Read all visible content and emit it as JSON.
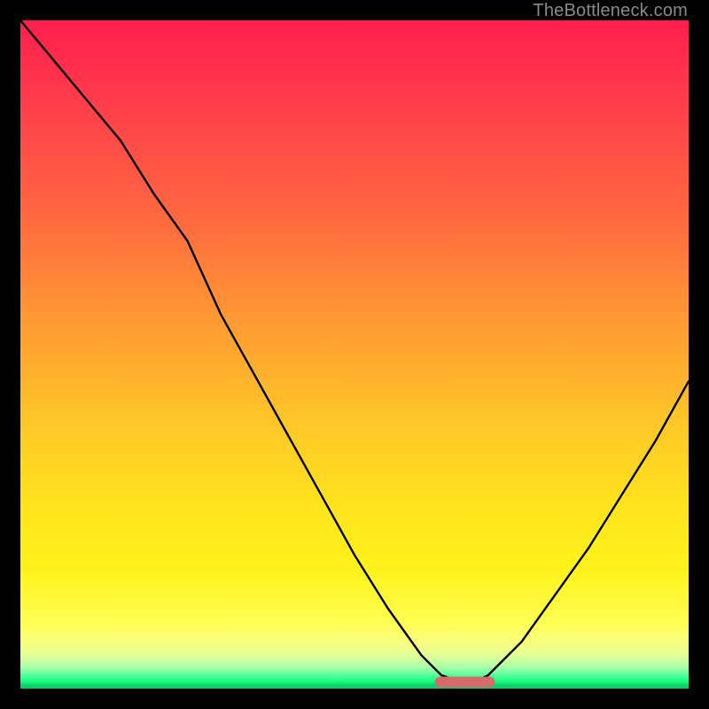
{
  "watermark": "TheBottleneck.com",
  "chart_data": {
    "type": "line",
    "title": "",
    "xlabel": "",
    "ylabel": "",
    "xlim": [
      0,
      100
    ],
    "ylim": [
      0,
      100
    ],
    "grid": false,
    "legend": false,
    "series": [
      {
        "name": "bottleneck-curve",
        "x": [
          0,
          5,
          10,
          15,
          20,
          25,
          30,
          35,
          40,
          45,
          50,
          55,
          60,
          63,
          66,
          68,
          70,
          75,
          80,
          85,
          90,
          95,
          100
        ],
        "values": [
          100,
          94,
          88,
          82,
          74,
          67,
          56,
          47,
          38,
          29,
          20,
          12,
          5,
          2,
          1,
          1,
          2,
          7,
          14,
          21,
          29,
          37,
          46
        ]
      }
    ],
    "highlight_segment": {
      "name": "optimal-range-pill",
      "x_start": 62,
      "x_end": 71,
      "y": 1,
      "color": "#d66a6a"
    },
    "background_gradient": {
      "stops": [
        {
          "pos": 0.0,
          "color": "#ff1e4d"
        },
        {
          "pos": 0.3,
          "color": "#ff6a3f"
        },
        {
          "pos": 0.6,
          "color": "#ffc627"
        },
        {
          "pos": 0.9,
          "color": "#ffff55"
        },
        {
          "pos": 1.0,
          "color": "#0cc762"
        }
      ]
    }
  }
}
